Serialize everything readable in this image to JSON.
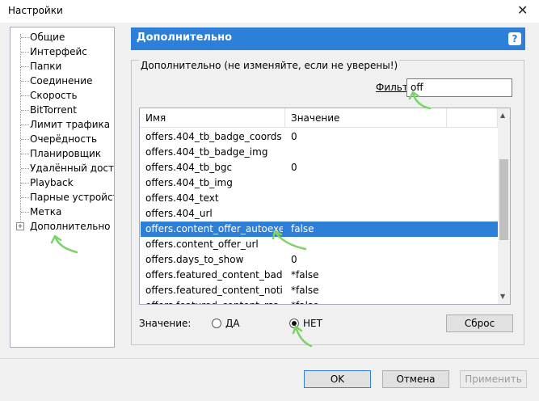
{
  "window": {
    "title": "Настройки",
    "close_glyph": "✕"
  },
  "sidebar": {
    "items": [
      {
        "label": "Общие"
      },
      {
        "label": "Интерфейс"
      },
      {
        "label": "Папки"
      },
      {
        "label": "Соединение"
      },
      {
        "label": "Скорость"
      },
      {
        "label": "BitTorrent"
      },
      {
        "label": "Лимит трафика"
      },
      {
        "label": "Очерёдность"
      },
      {
        "label": "Планировщик"
      },
      {
        "label": "Удалённый доступ"
      },
      {
        "label": "Playback"
      },
      {
        "label": "Парные устройства"
      },
      {
        "label": "Метка"
      },
      {
        "label": "Дополнительно",
        "expander": "+"
      }
    ]
  },
  "panel": {
    "title": "Дополнительно",
    "help": "?",
    "group_label": "Дополнительно (не изменяйте, если не уверены!)",
    "filter_label": "Фильтр:",
    "filter_value": "off"
  },
  "list": {
    "columns": [
      "Имя",
      "Значение"
    ],
    "rows": [
      {
        "name": "offers.404_tb_badge_coords",
        "value": "0"
      },
      {
        "name": "offers.404_tb_badge_img",
        "value": ""
      },
      {
        "name": "offers.404_tb_bgc",
        "value": "0"
      },
      {
        "name": "offers.404_tb_img",
        "value": ""
      },
      {
        "name": "offers.404_text",
        "value": ""
      },
      {
        "name": "offers.404_url",
        "value": ""
      },
      {
        "name": "offers.content_offer_autoexec",
        "value": "false",
        "selected": true
      },
      {
        "name": "offers.content_offer_url",
        "value": ""
      },
      {
        "name": "offers.days_to_show",
        "value": "0"
      },
      {
        "name": "offers.featured_content_badge...",
        "value": "*false"
      },
      {
        "name": "offers.featured_content_notific...",
        "value": "*false"
      },
      {
        "name": "offers.featured_content_rss_en...",
        "value": "*false"
      }
    ]
  },
  "value_row": {
    "label": "Значение:",
    "yes_label": "ДА",
    "no_label": "НЕТ",
    "selected": "no",
    "reset_label": "Сброс"
  },
  "footer": {
    "ok_label": "OK",
    "cancel_label": "Отмена",
    "apply_label": "Применить"
  },
  "colors": {
    "accent": "#2e7fd8",
    "annotation": "#7bd36a"
  }
}
